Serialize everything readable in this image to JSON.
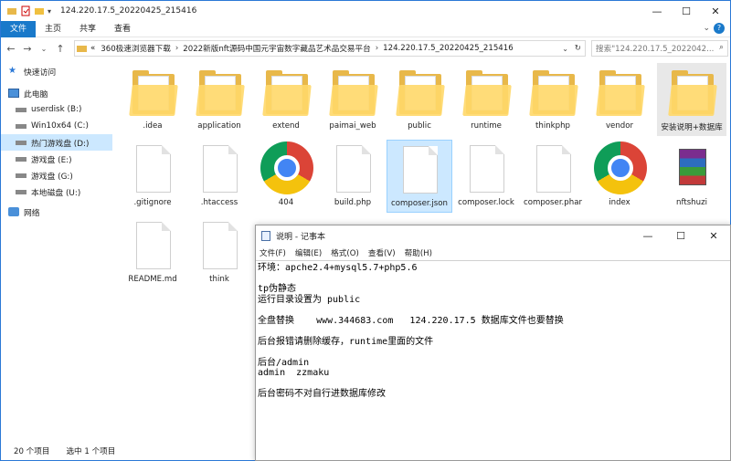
{
  "window": {
    "title": "124.220.17.5_20220425_215416",
    "controls": {
      "minimize": "—",
      "maximize": "☐",
      "close": "✕"
    }
  },
  "ribbon": {
    "tabs": [
      "文件",
      "主页",
      "共享",
      "查看"
    ]
  },
  "addressbar": {
    "prefix": "«",
    "segments": [
      "360极速浏览器下载",
      "2022新版nft源码中国元宇宙数字藏品艺术品交易平台",
      "124.220.17.5_20220425_215416"
    ]
  },
  "search": {
    "placeholder": "搜索\"124.220.17.5_2022042..."
  },
  "sidebar": {
    "items": [
      {
        "label": "快速访问",
        "icon": "star-icon"
      },
      {
        "label": "此电脑",
        "icon": "computer-icon"
      },
      {
        "label": "userdisk (B:)",
        "icon": "drive-icon"
      },
      {
        "label": "Win10x64 (C:)",
        "icon": "drive-icon"
      },
      {
        "label": "热门游戏盘 (D:)",
        "icon": "drive-icon",
        "selected": true
      },
      {
        "label": "游戏盘 (E:)",
        "icon": "drive-icon"
      },
      {
        "label": "游戏盘 (G:)",
        "icon": "drive-icon"
      },
      {
        "label": "本地磁盘 (U:)",
        "icon": "drive-icon"
      },
      {
        "label": "网络",
        "icon": "network-icon"
      }
    ]
  },
  "files": [
    {
      "name": ".idea",
      "type": "folder"
    },
    {
      "name": "application",
      "type": "folder"
    },
    {
      "name": "extend",
      "type": "folder"
    },
    {
      "name": "paimai_web",
      "type": "folder"
    },
    {
      "name": "public",
      "type": "folder"
    },
    {
      "name": "runtime",
      "type": "folder"
    },
    {
      "name": "thinkphp",
      "type": "folder"
    },
    {
      "name": "vendor",
      "type": "folder"
    },
    {
      "name": "安装说明+数据库",
      "type": "folder"
    },
    {
      "name": ".gitignore",
      "type": "file"
    },
    {
      "name": ".htaccess",
      "type": "file"
    },
    {
      "name": "404",
      "type": "chrome"
    },
    {
      "name": "build.php",
      "type": "file"
    },
    {
      "name": "composer.json",
      "type": "file",
      "selected": true
    },
    {
      "name": "composer.lock",
      "type": "file"
    },
    {
      "name": "composer.phar",
      "type": "file"
    },
    {
      "name": "index",
      "type": "chrome"
    },
    {
      "name": "nftshuzi",
      "type": "rar"
    },
    {
      "name": "README.md",
      "type": "file"
    },
    {
      "name": "think",
      "type": "file"
    }
  ],
  "status": {
    "count": "20 个项目",
    "selected": "选中 1 个项目"
  },
  "notepad": {
    "title": "说明 - 记事本",
    "menu": [
      "文件(F)",
      "编辑(E)",
      "格式(O)",
      "查看(V)",
      "帮助(H)"
    ],
    "lines": [
      "环境：apche2.4+mysql5.7+php5.6",
      "",
      "tp伪静态",
      "运行目录设置为 public",
      "",
      "全盘替换    www.344683.com   124.220.17.5 数据库文件也要替换",
      "",
      "后台报错请删除缓存，runtime里面的文件",
      "",
      "后台/admin",
      "admin  zzmaku",
      "",
      "后台密码不对自行进数据库修改"
    ]
  }
}
